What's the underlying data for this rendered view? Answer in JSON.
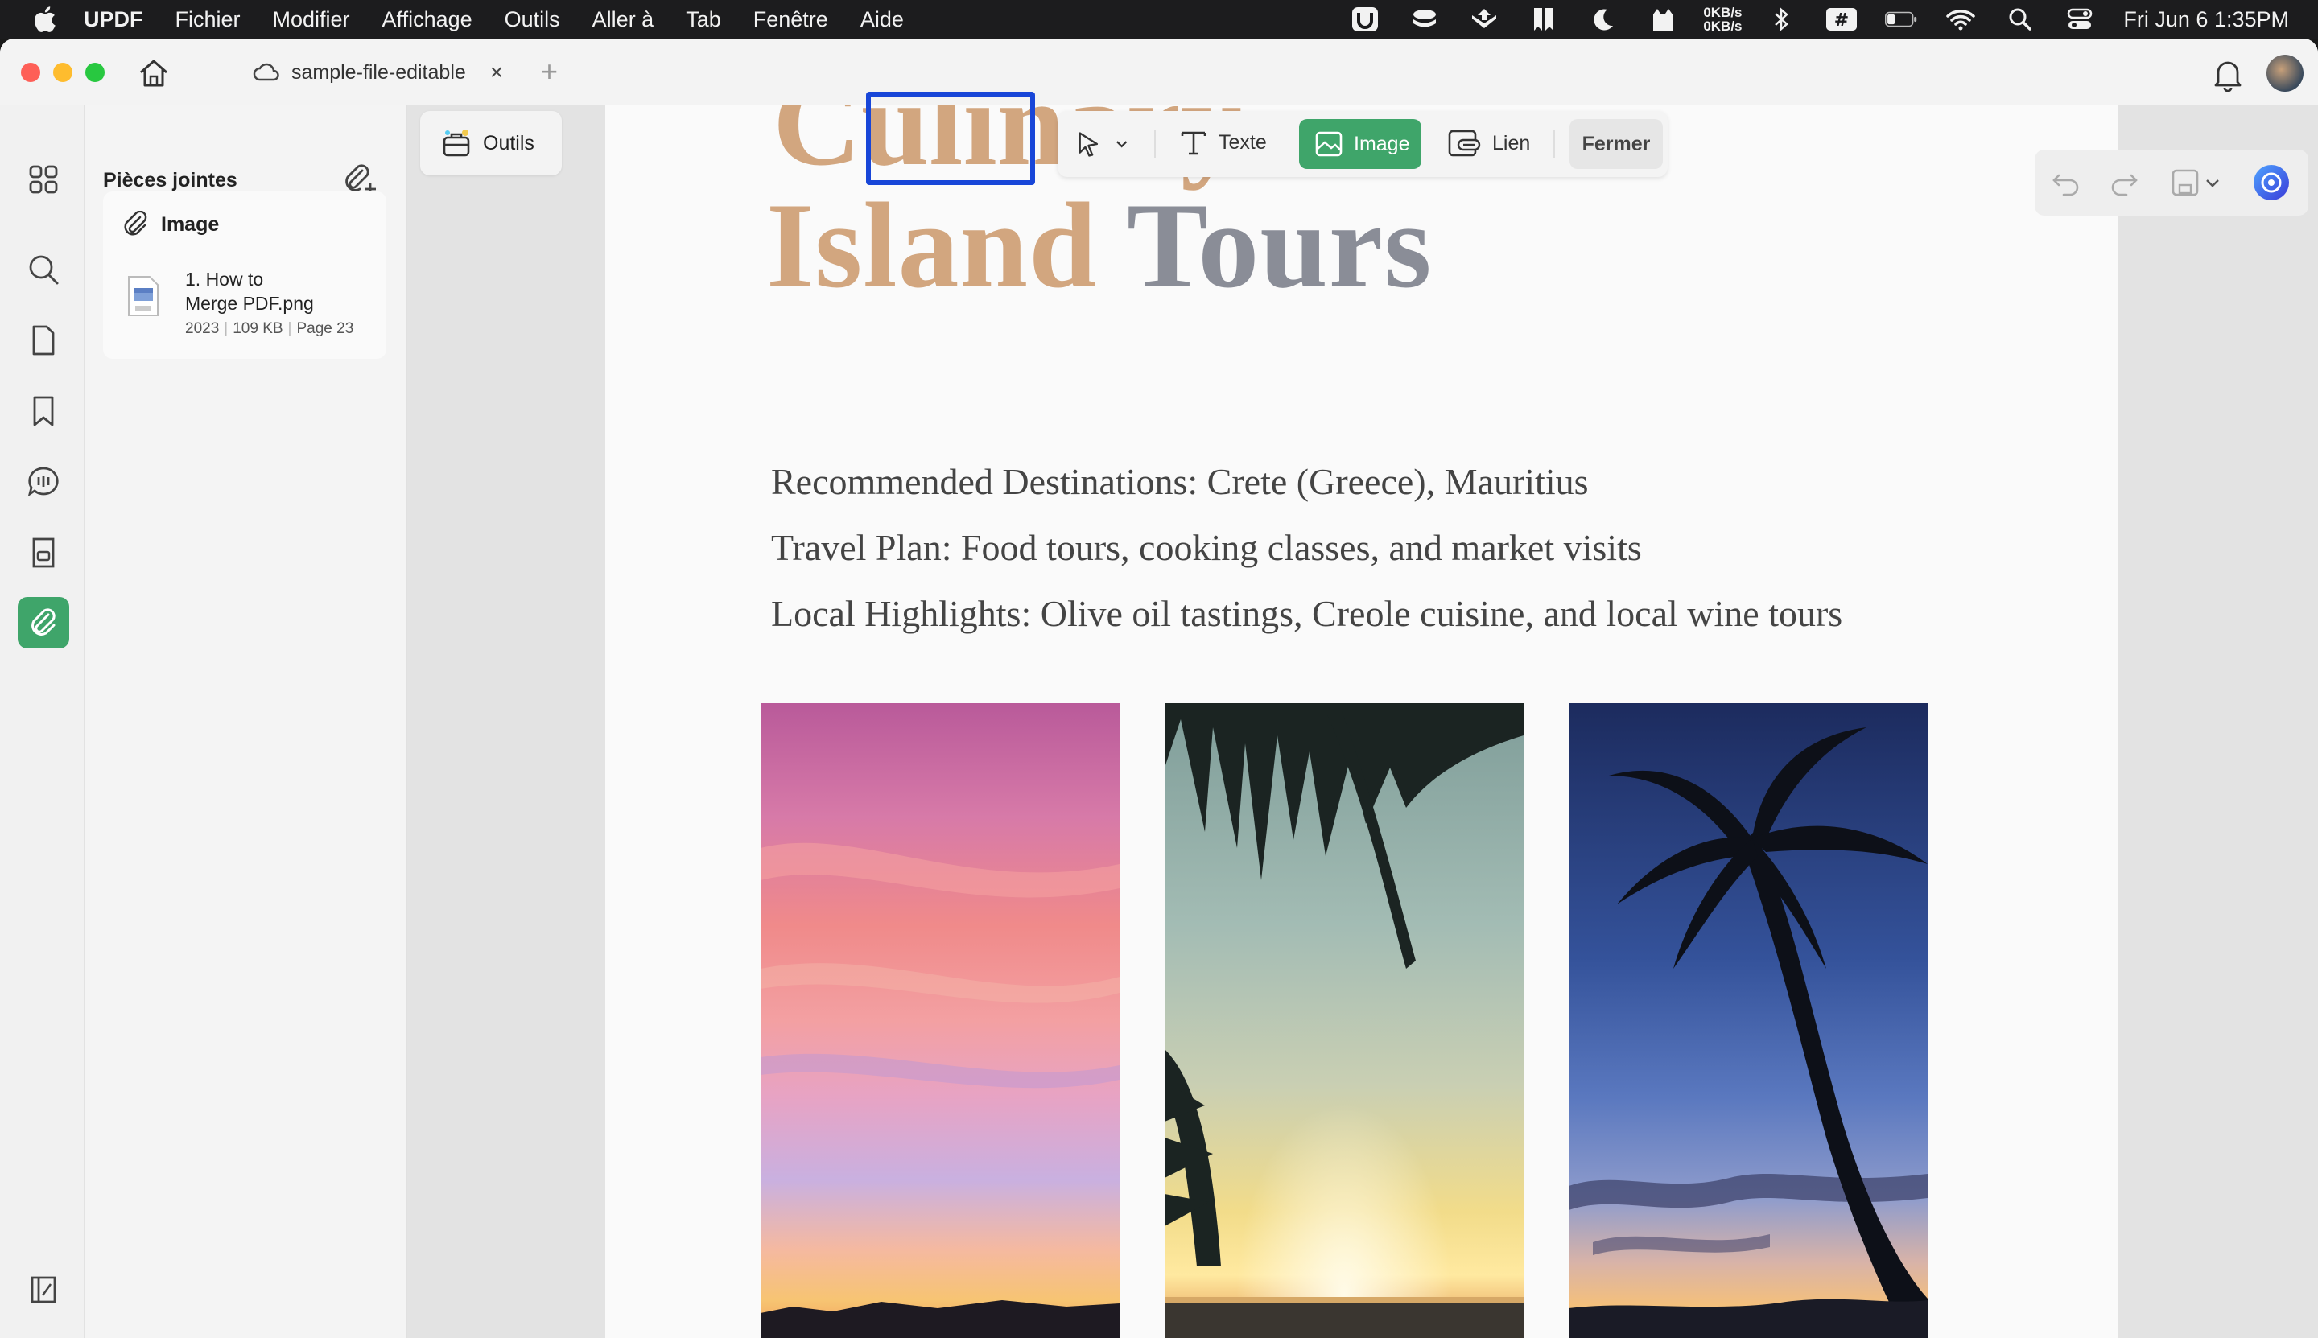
{
  "menubar": {
    "app_name": "UPDF",
    "menus": [
      "Fichier",
      "Modifier",
      "Affichage",
      "Outils",
      "Aller à",
      "Tab",
      "Fenêtre",
      "Aide"
    ],
    "network_up": "0KB/s",
    "network_down": "0KB/s",
    "clock": "Fri Jun 6  1:35PM"
  },
  "window": {
    "tab_title": "sample-file-editable",
    "tab_close": "×",
    "new_tab": "+"
  },
  "sidebar_panel": {
    "title": "Pièces jointes",
    "card": {
      "header": "Image",
      "file_name": "1. How to Merge PDF.png",
      "file_name_line1": "1. How to",
      "file_name_line2": "Merge PDF.png",
      "year": "2023",
      "size": "109 KB",
      "page": "Page 23"
    }
  },
  "toolbar": {
    "tools_label": "Outils",
    "text_label": "Texte",
    "image_label": "Image",
    "link_label": "Lien",
    "close_label": "Fermer"
  },
  "document": {
    "title_top_partial": "Culinary",
    "title_word1": "Island",
    "title_word2": "Tours",
    "lines": [
      "Recommended Destinations: Crete (Greece), Mauritius",
      "Travel Plan: Food tours, cooking classes, and market visits",
      "Local Highlights: Olive oil tastings, Creole cuisine, and local wine tours"
    ]
  },
  "colors": {
    "accent_green": "#3fa56a",
    "highlight_blue": "#1846d8",
    "title_tan": "#d2a67f",
    "title_grey": "#8a8d97"
  }
}
